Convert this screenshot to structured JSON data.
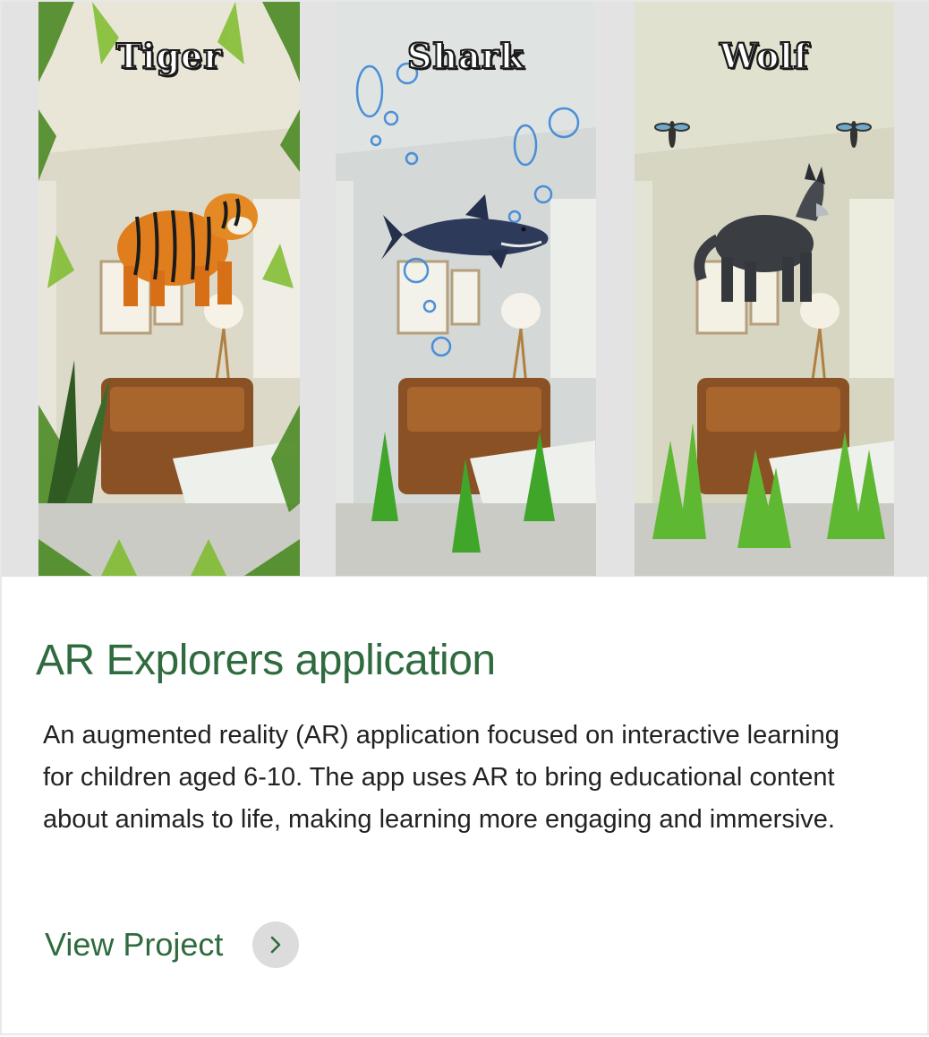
{
  "gallery": {
    "panels": [
      {
        "label": "Tiger",
        "animal_icon": "tiger-icon",
        "theme": "jungle"
      },
      {
        "label": "Shark",
        "animal_icon": "shark-icon",
        "theme": "underwater"
      },
      {
        "label": "Wolf",
        "animal_icon": "wolf-icon",
        "theme": "grassland"
      }
    ]
  },
  "project": {
    "title": "AR Explorers application",
    "description": "An augmented reality (AR) application focused on interactive learning for children aged 6-10. The app uses AR to bring educational content about animals to life, making learning more engaging and immersive.",
    "link_label": "View Project",
    "link_icon": "chevron-right-icon"
  },
  "colors": {
    "accent": "#2f6b3f",
    "text": "#222222",
    "button_bg": "#dcdcdc"
  }
}
